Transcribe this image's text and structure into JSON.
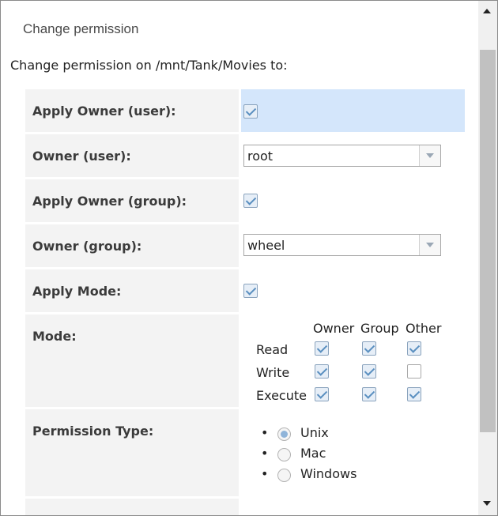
{
  "dialog": {
    "title": "Change permission",
    "intro": "Change permission on /mnt/Tank/Movies to:"
  },
  "form": {
    "apply_owner_user": {
      "label": "Apply Owner (user):",
      "checked": true
    },
    "owner_user": {
      "label": "Owner (user):",
      "value": "root"
    },
    "apply_owner_group": {
      "label": "Apply Owner (group):",
      "checked": true
    },
    "owner_group": {
      "label": "Owner (group):",
      "value": "wheel"
    },
    "apply_mode": {
      "label": "Apply Mode:",
      "checked": true
    },
    "mode": {
      "label": "Mode:",
      "columns": [
        "Owner",
        "Group",
        "Other"
      ],
      "rows": [
        {
          "name": "Read",
          "values": [
            true,
            true,
            true
          ]
        },
        {
          "name": "Write",
          "values": [
            true,
            true,
            false
          ]
        },
        {
          "name": "Execute",
          "values": [
            true,
            true,
            true
          ]
        }
      ]
    },
    "permission_type": {
      "label": "Permission Type:",
      "options": [
        "Unix",
        "Mac",
        "Windows"
      ],
      "selected": "Unix",
      "bullet": "•"
    }
  },
  "colors": {
    "highlight": "#d4e6fb",
    "label_bg": "#f3f3f3",
    "checkbox_check": "#5a8fc0"
  }
}
